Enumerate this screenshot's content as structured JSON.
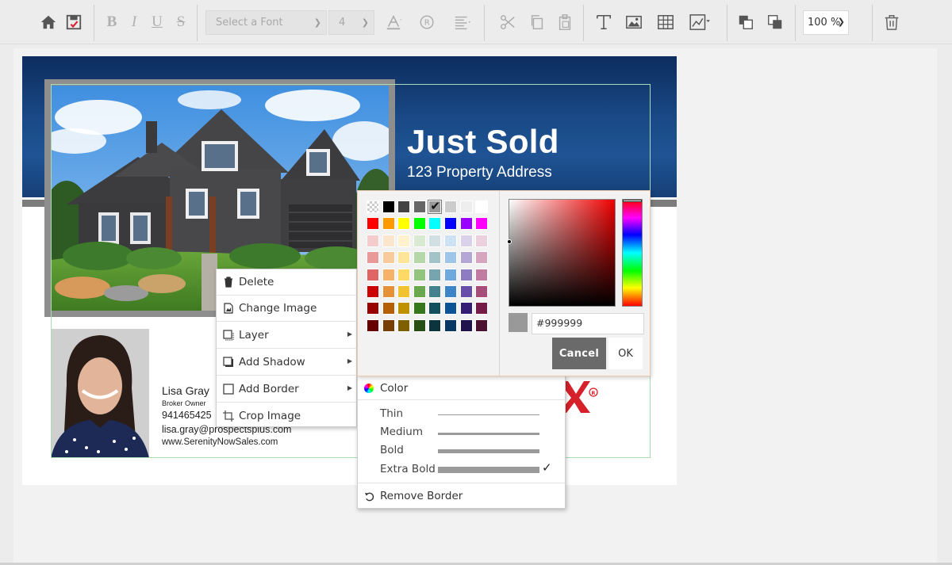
{
  "toolbar": {
    "font_placeholder": "Select a Font",
    "font_size": "4",
    "zoom": "100 %",
    "icons": [
      "home-icon",
      "save-icon",
      "bold-icon",
      "italic-icon",
      "underline-icon",
      "strikethrough-icon",
      "font-color-icon",
      "registered-icon",
      "align-icon",
      "cut-icon",
      "copy-icon",
      "paste-icon",
      "text-tool-icon",
      "image-tool-icon",
      "table-tool-icon",
      "chart-tool-icon",
      "bring-forward-icon",
      "send-backward-icon",
      "trash-icon"
    ]
  },
  "card": {
    "headline": "Just Sold",
    "address": "123 Property Address",
    "agent": {
      "name": "Lisa Gray",
      "title": "Broker Owner",
      "phone": "941465425",
      "email": "lisa.gray@prospectsplus.com",
      "website": "www.SerenityNowSales.com"
    }
  },
  "context_menu": {
    "items": [
      {
        "label": "Delete",
        "icon": "trash-icon"
      },
      {
        "label": "Change Image",
        "icon": "image-file-icon"
      },
      {
        "label": "Layer",
        "icon": "layer-icon",
        "has_submenu": true
      },
      {
        "label": "Add Shadow",
        "icon": "shadow-icon",
        "has_submenu": true
      },
      {
        "label": "Add Border",
        "icon": "border-icon",
        "has_submenu": true
      },
      {
        "label": "Crop Image",
        "icon": "crop-icon"
      }
    ]
  },
  "border_menu": {
    "color_label": "Color",
    "widths": [
      {
        "label": "Thin"
      },
      {
        "label": "Medium"
      },
      {
        "label": "Bold"
      },
      {
        "label": "Extra Bold",
        "selected": true
      }
    ],
    "check_mark": "✓",
    "remove_label": "Remove Border"
  },
  "color_picker": {
    "hex_value": "#999999",
    "cancel_label": "Cancel",
    "ok_label": "OK",
    "preview_color": "#999999",
    "swatches": [
      [
        "transparent",
        "#000000",
        "#444444",
        "#666666",
        "#999999",
        "#cccccc",
        "#eeeeee",
        "#ffffff"
      ],
      [
        "#ff0000",
        "#ff9900",
        "#ffff00",
        "#00ff00",
        "#00ffff",
        "#0000ff",
        "#9900ff",
        "#ff00ff"
      ],
      [
        "#f4cccc",
        "#fce5cd",
        "#fff2cc",
        "#d9ead3",
        "#d0e0e3",
        "#cfe2f3",
        "#d9d2e9",
        "#ead1dc"
      ],
      [
        "#ea9999",
        "#f9cb9c",
        "#ffe599",
        "#b6d7a8",
        "#a2c4c9",
        "#9fc5e8",
        "#b4a7d6",
        "#d5a6bd"
      ],
      [
        "#e06666",
        "#f6b26b",
        "#ffd966",
        "#93c47d",
        "#76a5af",
        "#6fa8dc",
        "#8e7cc3",
        "#c27ba0"
      ],
      [
        "#cc0000",
        "#e69138",
        "#f1c232",
        "#6aa84f",
        "#45818e",
        "#3d85c6",
        "#674ea7",
        "#a64d79"
      ],
      [
        "#990000",
        "#b45f06",
        "#bf9000",
        "#38761d",
        "#134f5c",
        "#0b5394",
        "#351c75",
        "#741b47"
      ],
      [
        "#660000",
        "#783f04",
        "#7f6000",
        "#274e13",
        "#0c343d",
        "#073763",
        "#20124d",
        "#4c1130"
      ]
    ],
    "selected_swatch": "#999999"
  }
}
